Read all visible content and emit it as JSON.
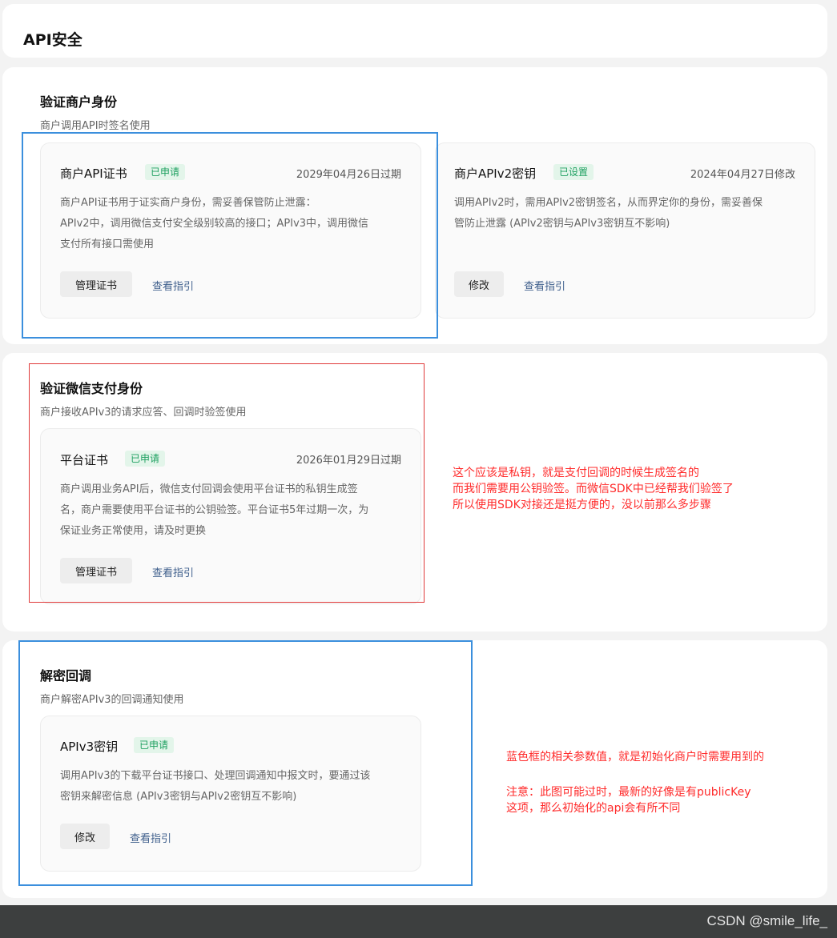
{
  "header": {
    "title": "API安全"
  },
  "section_merchant": {
    "title": "验证商户身份",
    "desc": "商户调用API时签名使用",
    "cards": [
      {
        "name": "商户API证书",
        "badge": "已申请",
        "date": "2029年04月26日过期",
        "desc_lines": [
          "商户API证书用于证实商户身份，需妥善保管防止泄露：",
          "APIv2中，调用微信支付安全级别较高的接口；APIv3中，调用微信",
          "支付所有接口需使用"
        ],
        "button": "管理证书",
        "link": "查看指引"
      },
      {
        "name": "商户APIv2密钥",
        "badge": "已设置",
        "date": "2024年04月27日修改",
        "desc_lines": [
          "调用APIv2时，需用APIv2密钥签名，从而界定你的身份，需妥善保",
          "管防止泄露 (APIv2密钥与APIv3密钥互不影响)"
        ],
        "button": "修改",
        "link": "查看指引"
      }
    ]
  },
  "section_wechat": {
    "title": "验证微信支付身份",
    "desc": "商户接收APIv3的请求应答、回调时验签使用",
    "card": {
      "name": "平台证书",
      "badge": "已申请",
      "date": "2026年01月29日过期",
      "desc_lines": [
        "商户调用业务API后，微信支付回调会使用平台证书的私钥生成签",
        "名，商户需要使用平台证书的公钥验签。平台证书5年过期一次，为",
        "保证业务正常使用，请及时更换"
      ],
      "button": "管理证书",
      "link": "查看指引"
    }
  },
  "section_decrypt": {
    "title": "解密回调",
    "desc": "商户解密APIv3的回调通知使用",
    "card": {
      "name": "APIv3密钥",
      "badge": "已申请",
      "desc_lines": [
        "调用APIv3的下载平台证书接口、处理回调通知中报文时，要通过该",
        "密钥来解密信息 (APIv3密钥与APIv2密钥互不影响)"
      ],
      "button": "修改",
      "link": "查看指引"
    }
  },
  "annotations": {
    "note1_lines": [
      "这个应该是私钥，就是支付回调的时候生成签名的",
      "而我们需要用公钥验签。而微信SDK中已经帮我们验签了",
      "所以使用SDK对接还是挺方便的，没以前那么多步骤"
    ],
    "note2_line": "蓝色框的相关参数值，就是初始化商户时需要用到的",
    "note3_lines": [
      "注意：此图可能过时，最新的好像是有publicKey",
      "这项，那么初始化的api会有所不同"
    ],
    "colors": {
      "blue_box": "#3b8fdd",
      "red_box": "#e03a3a",
      "red_text": "#ff2b2b"
    }
  },
  "watermark": "CSDN @smile_life_"
}
